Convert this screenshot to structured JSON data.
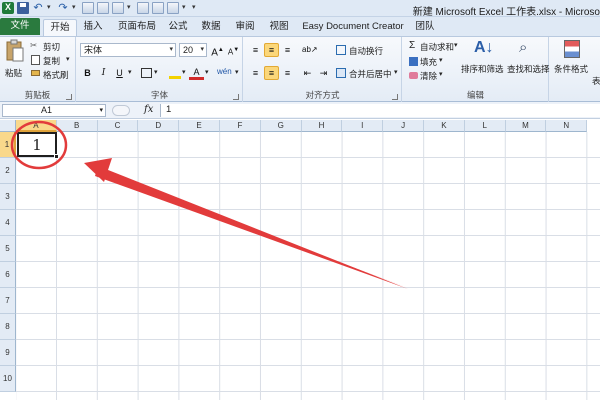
{
  "window": {
    "title": "新建 Microsoft Excel 工作表.xlsx - Microso"
  },
  "ribbon_tabs": [
    {
      "label": "文件"
    },
    {
      "label": "开始"
    },
    {
      "label": "插入"
    },
    {
      "label": "页面布局"
    },
    {
      "label": "公式"
    },
    {
      "label": "数据"
    },
    {
      "label": "审阅"
    },
    {
      "label": "视图"
    },
    {
      "label": "Easy Document Creator"
    },
    {
      "label": "团队"
    }
  ],
  "active_tab": "开始",
  "clipboard": {
    "paste": "粘贴",
    "cut": "剪切",
    "copy": "复制",
    "format_painter": "格式刷",
    "group_label": "剪贴板"
  },
  "font": {
    "name": "宋体",
    "size": "20",
    "grow": "A",
    "shrink": "A",
    "bold": "B",
    "italic": "I",
    "underline": "U",
    "font_color_glyph": "A",
    "phonetic_glyph": "wén",
    "group_label": "字体"
  },
  "alignment": {
    "wrap_text": "自动换行",
    "merge_center": "合并后居中",
    "group_label": "对齐方式"
  },
  "editing": {
    "autosum": "自动求和",
    "fill": "填充",
    "clear": "清除",
    "sort_filter": "排序和筛选",
    "find_select": "查找和选择",
    "group_label": "编辑"
  },
  "styles": {
    "conditional_format": "条件格式",
    "table_label": "表"
  },
  "formula_bar": {
    "name_box": "A1",
    "fx": "fx",
    "content": "1"
  },
  "columns": [
    "A",
    "B",
    "C",
    "D",
    "E",
    "F",
    "G",
    "H",
    "I",
    "J",
    "K",
    "L",
    "M",
    "N"
  ],
  "rows": [
    "1",
    "2",
    "3",
    "4",
    "5",
    "6",
    "7",
    "8",
    "9",
    "10"
  ],
  "active_cell": {
    "ref": "A1",
    "value": "1"
  },
  "colors": {
    "file_tab": "#2a7a3e",
    "selected_header": "#f9d88b",
    "annotation": "#e23b3b"
  }
}
